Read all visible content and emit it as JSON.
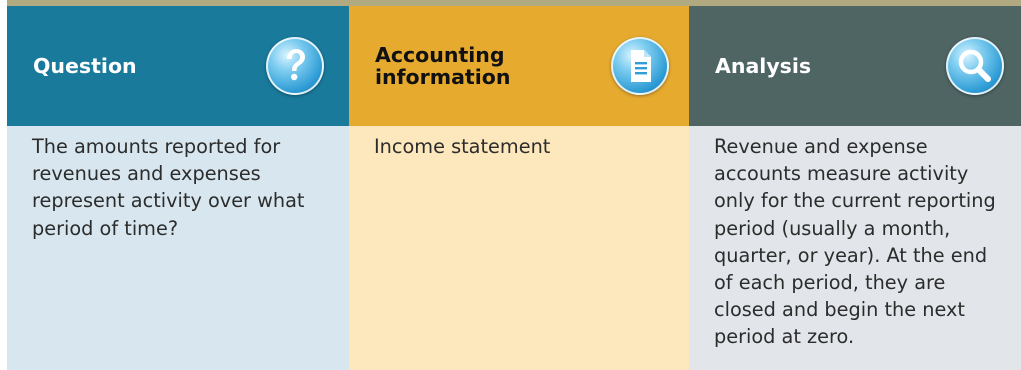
{
  "columns": [
    {
      "id": "question",
      "header": "Question",
      "icon": "question-icon",
      "body": "The amounts reported for revenues and expenses represent activity over what period of time?",
      "header_color": "#1a7a9c",
      "body_color": "#d8e7ef"
    },
    {
      "id": "accounting",
      "header": "Accounting information",
      "icon": "document-icon",
      "body": "Income statement",
      "header_color": "#e6aa2f",
      "body_color": "#fde8bd"
    },
    {
      "id": "analysis",
      "header": "Analysis",
      "icon": "magnifier-icon",
      "body": "Revenue and expense accounts measure activity only for the current reporting period (usually a month, quarter, or year). At the end of each period, they are closed and begin the next period at zero.",
      "header_color": "#4e6563",
      "body_color": "#e2e6ea"
    }
  ]
}
